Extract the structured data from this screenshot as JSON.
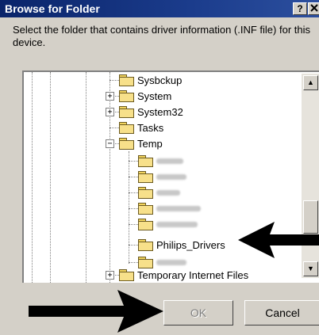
{
  "window": {
    "title": "Browse for Folder",
    "help_label": "?"
  },
  "instruction": "Select the folder that contains driver information (.INF file) for this device.",
  "tree": {
    "items": [
      {
        "label": "Sysbckup"
      },
      {
        "label": "System"
      },
      {
        "label": "System32"
      },
      {
        "label": "Tasks"
      },
      {
        "label": "Temp"
      },
      {
        "label": ""
      },
      {
        "label": ""
      },
      {
        "label": ""
      },
      {
        "label": ""
      },
      {
        "label": ""
      },
      {
        "label": "Philips_Drivers"
      },
      {
        "label": ""
      },
      {
        "label": "Temporary Internet Files"
      }
    ]
  },
  "buttons": {
    "ok": "OK",
    "cancel": "Cancel"
  }
}
